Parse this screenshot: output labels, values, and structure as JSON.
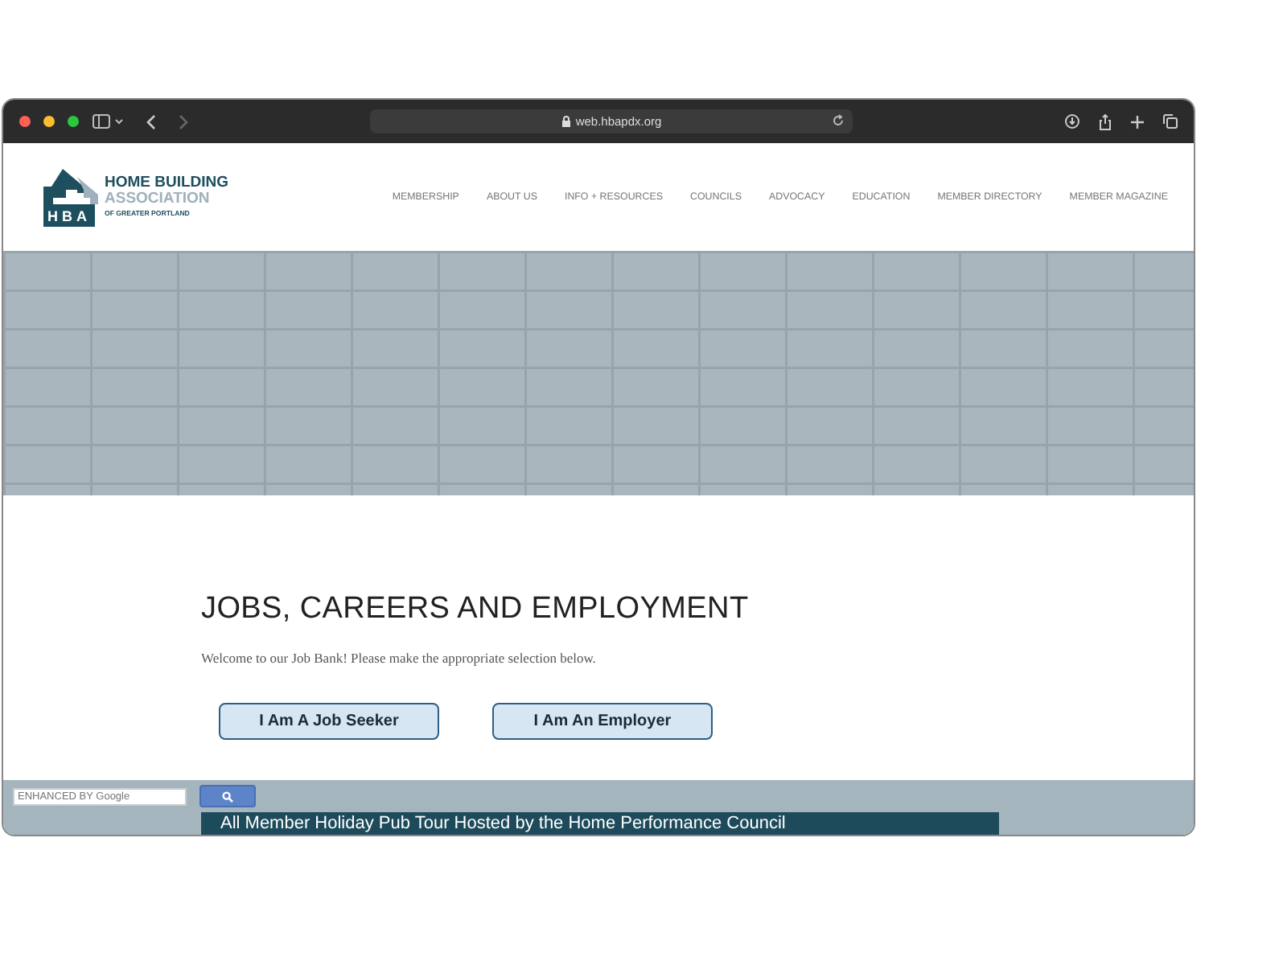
{
  "browser": {
    "url": "web.hbapdx.org"
  },
  "logo": {
    "mark": "HBA",
    "line_1": "HOME BUILDING",
    "line_2": "ASSOCIATION",
    "line_3": "OF GREATER PORTLAND"
  },
  "nav": [
    "MEMBERSHIP",
    "ABOUT US",
    "INFO + RESOURCES",
    "COUNCILS",
    "ADVOCACY",
    "EDUCATION",
    "MEMBER DIRECTORY",
    "MEMBER MAGAZINE"
  ],
  "page": {
    "title": "JOBS, CAREERS AND EMPLOYMENT",
    "intro": "Welcome to our Job Bank! Please make the appropriate selection below.",
    "buttons": [
      "I Am A Job Seeker",
      "I Am An Employer"
    ]
  },
  "search": {
    "placeholder": "ENHANCED BY Google"
  },
  "banner": {
    "text": "All Member Holiday Pub Tour Hosted by the Home Performance Council"
  }
}
